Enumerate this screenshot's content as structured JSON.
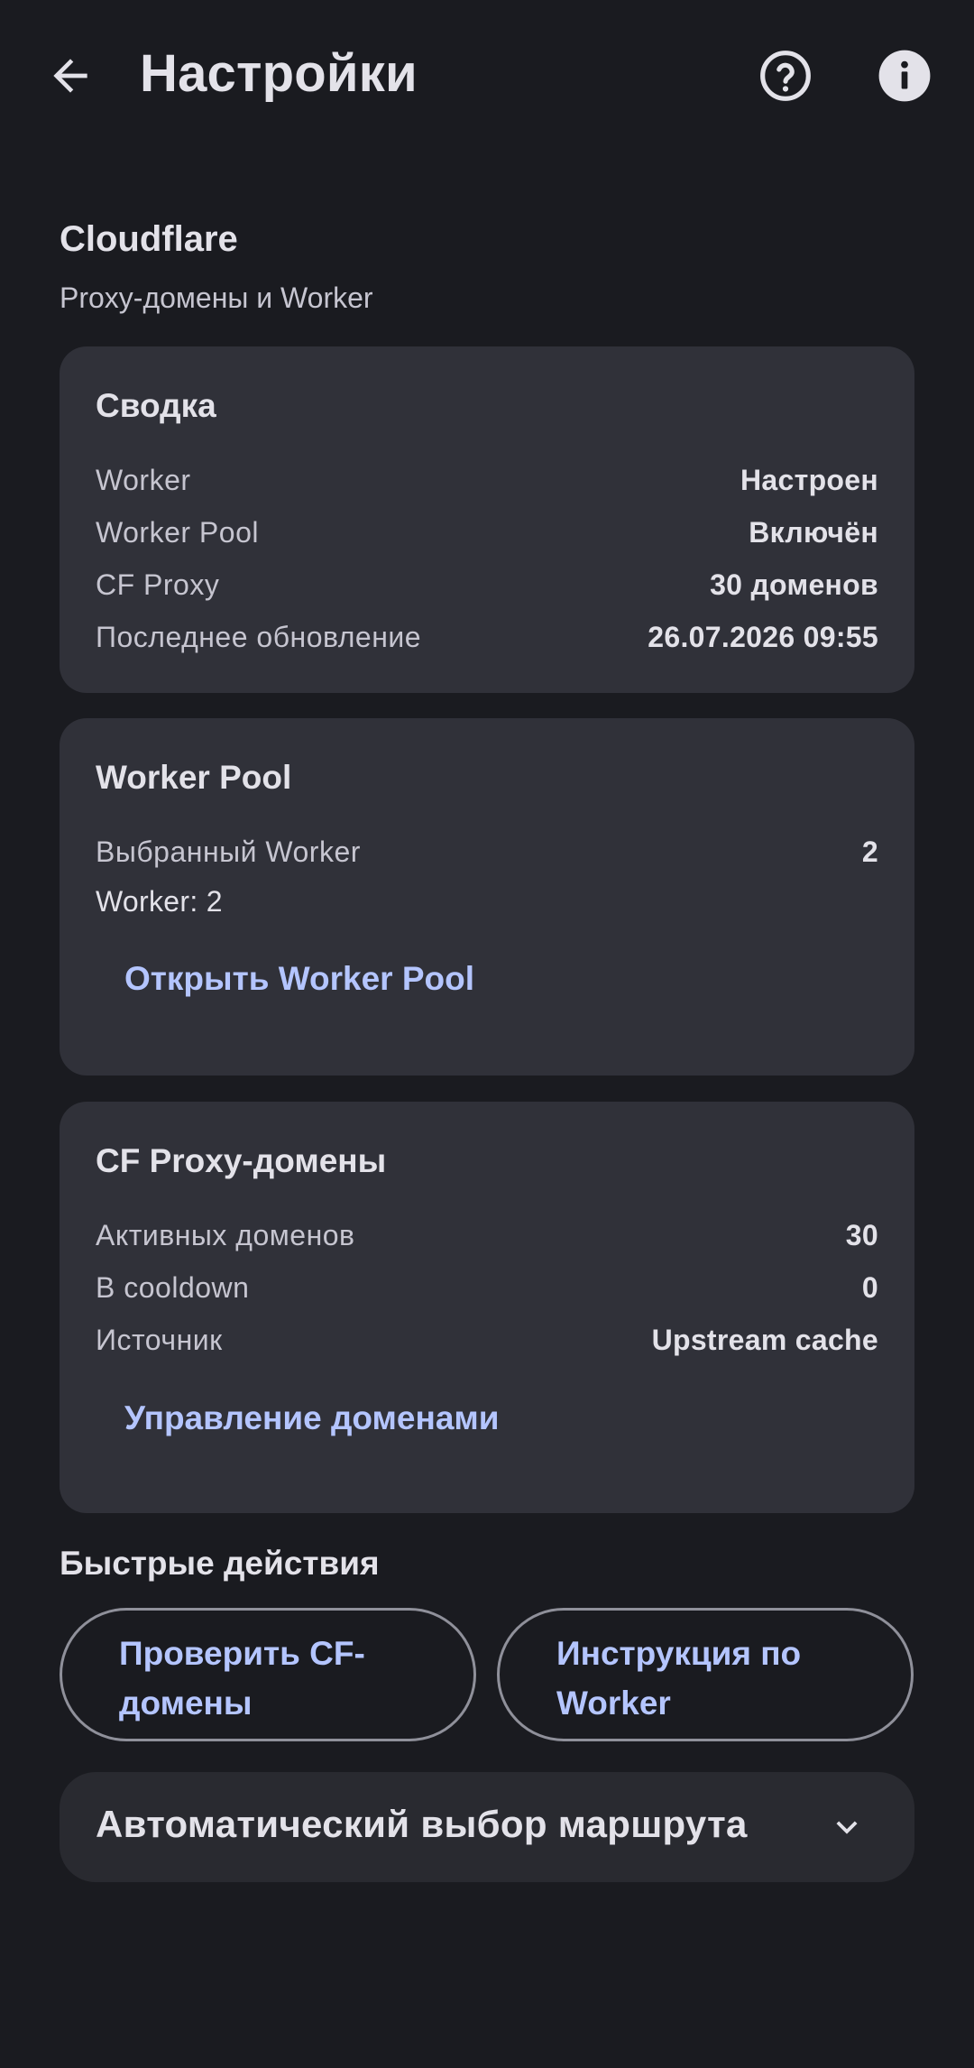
{
  "app_bar": {
    "title": "Настройки",
    "back_icon": "arrow-back-icon",
    "help_icon": "help-circle-icon",
    "info_icon": "info-icon"
  },
  "section": {
    "title": "Cloudflare",
    "subtitle": "Proxy-домены и Worker"
  },
  "summary_card": {
    "title": "Сводка",
    "rows": [
      {
        "label": "Worker",
        "value": "Настроен"
      },
      {
        "label": "Worker Pool",
        "value": "Включён"
      },
      {
        "label": "CF Proxy",
        "value": "30 доменов"
      },
      {
        "label": "Последнее обновление",
        "value": "26.07.2026 09:55"
      }
    ]
  },
  "worker_pool_card": {
    "title": "Worker Pool",
    "selected_label": "Выбранный Worker",
    "selected_value": "2",
    "worker_line": "Worker: 2",
    "open_button": "Открыть Worker Pool"
  },
  "cf_proxy_card": {
    "title": "CF Proxy-домены",
    "rows": [
      {
        "label": "Активных доменов",
        "value": "30"
      },
      {
        "label": "В cooldown",
        "value": "0"
      },
      {
        "label": "Источник",
        "value": "Upstream cache"
      }
    ],
    "manage_button": "Управление доменами"
  },
  "quick_actions": {
    "title": "Быстрые действия",
    "check_button": "Проверить CF-домены",
    "guide_button": "Инструкция по Worker"
  },
  "auto_route": {
    "title": "Автоматический выбор маршрута",
    "chevron_icon": "chevron-down-icon"
  },
  "colors": {
    "background": "#1a1b20",
    "card": "#303139",
    "accent": "#b4c5ff",
    "text": "#e3e2e9",
    "secondary_text": "#c6c5d0"
  }
}
